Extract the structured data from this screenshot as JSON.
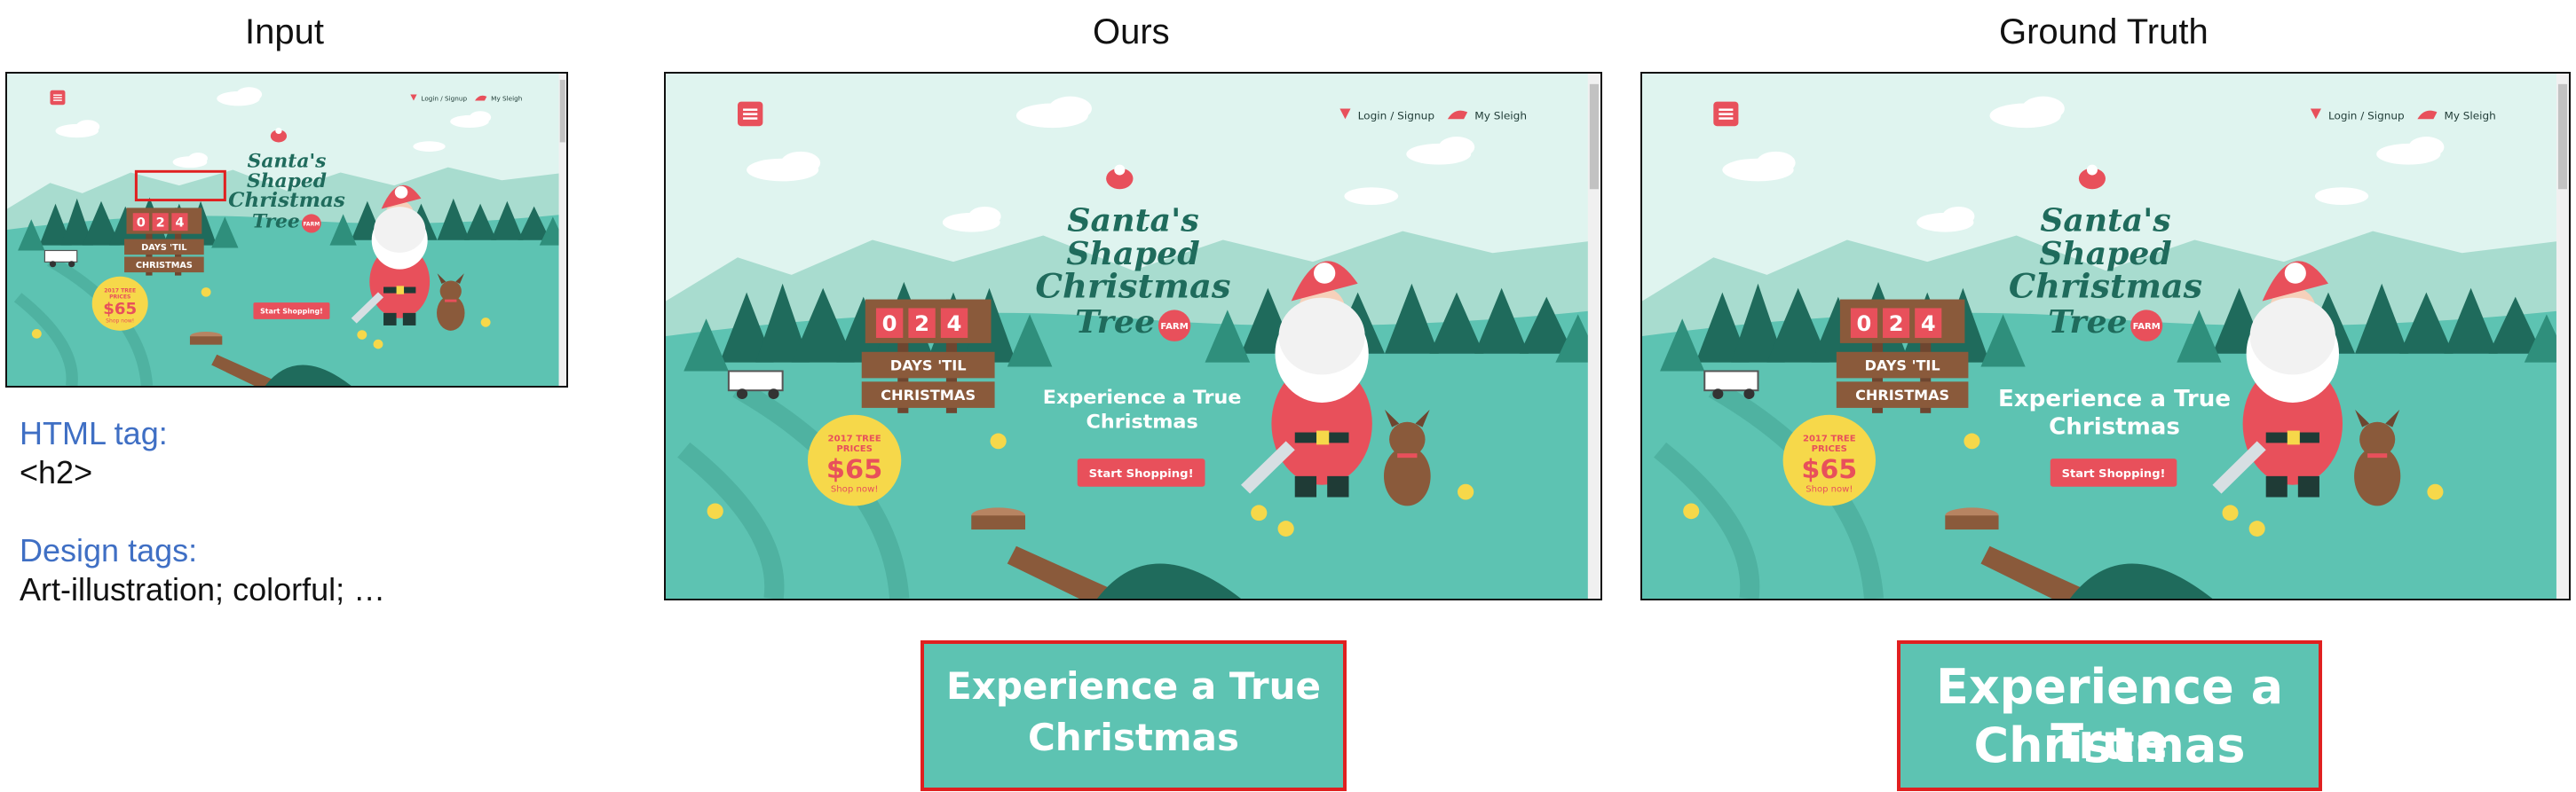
{
  "columns": {
    "input": "Input",
    "ours": "Ours",
    "truth": "Ground Truth"
  },
  "labels": {
    "html_tag_heading": "HTML tag:",
    "html_tag_value": "<h2>",
    "design_tags_heading": "Design tags:",
    "design_tags_value": "Art-illustration; colorful; …"
  },
  "site": {
    "login": "Login / Signup",
    "sleigh": "My Sleigh",
    "logo_line1": "Santa's",
    "logo_line2": "Shaped",
    "logo_line3": "Christmas",
    "logo_line4": "Tree",
    "logo_badge": "FARM",
    "counter_digits": [
      "0",
      "2",
      "4"
    ],
    "days_line1": "DAYS 'TIL",
    "days_line2": "CHRISTMAS",
    "price_caption": "2017 TREE PRICES",
    "price_value": "$65",
    "price_cta": "Shop now!",
    "cta_button": "Start Shopping!",
    "headline_line1": "Experience a True",
    "headline_line2": "Christmas"
  },
  "crops": {
    "ours_line1": "Experience a True",
    "ours_line2": "Christmas",
    "truth_line1": "Experience a True",
    "truth_line2": "Christmas"
  },
  "colors": {
    "sky": "#dff4ef",
    "teal": "#5dc3b2",
    "dark_teal": "#1f6b5c",
    "forest": "#2f8f7c",
    "mountain": "#a8dccf",
    "red": "#e8505b",
    "wood": "#8a5a3b",
    "crop_border": "#e02020"
  }
}
